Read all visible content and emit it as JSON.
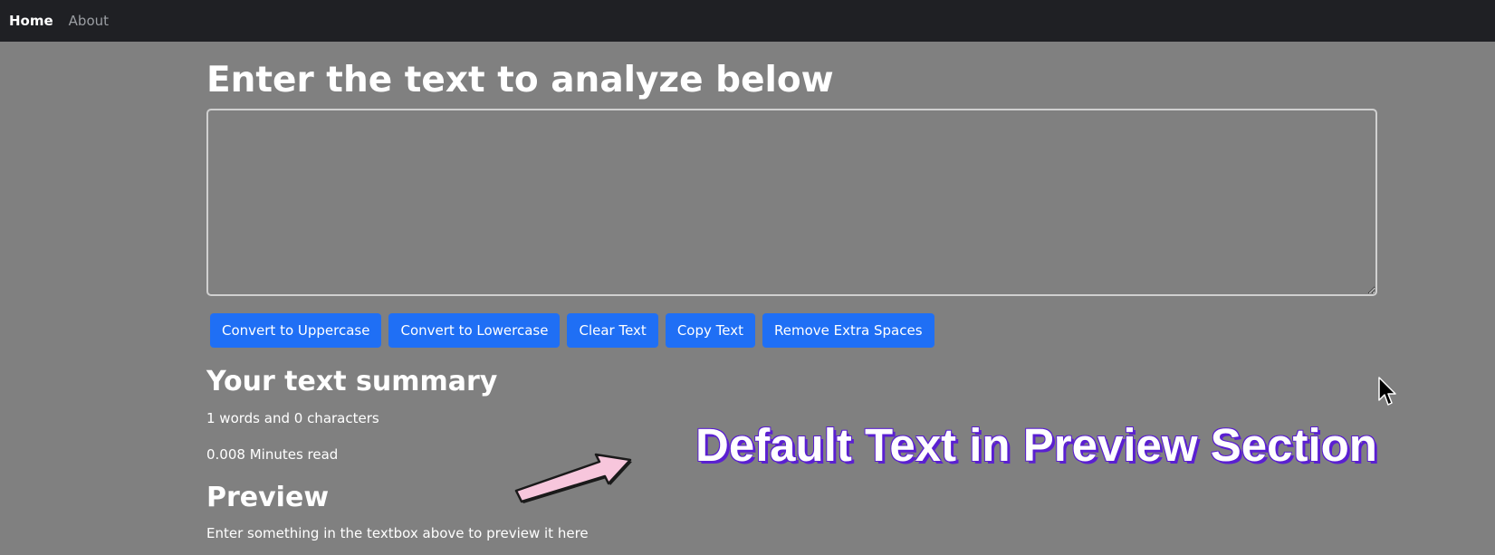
{
  "nav": {
    "home": "Home",
    "about": "About"
  },
  "main": {
    "title": "Enter the text to analyze below",
    "textarea_value": "",
    "buttons": {
      "uppercase": "Convert to Uppercase",
      "lowercase": "Convert to Lowercase",
      "clear": "Clear Text",
      "copy": "Copy Text",
      "remove_spaces": "Remove Extra Spaces"
    },
    "summary_title": "Your text summary",
    "words_line": "1 words and 0 characters",
    "read_line": "0.008 Minutes read",
    "preview_title": "Preview",
    "preview_text": "Enter something in the textbox above to preview it here"
  },
  "overlay": {
    "caption": "Default Text in Preview Section",
    "arrow_icon": "arrow-up-right-icon"
  },
  "colors": {
    "navbar": "#1f2024",
    "page_bg": "#808080",
    "button": "#1f6ff5",
    "caption_shadow": "#5a1fd1",
    "arrow_fill": "#f7c6dc"
  }
}
